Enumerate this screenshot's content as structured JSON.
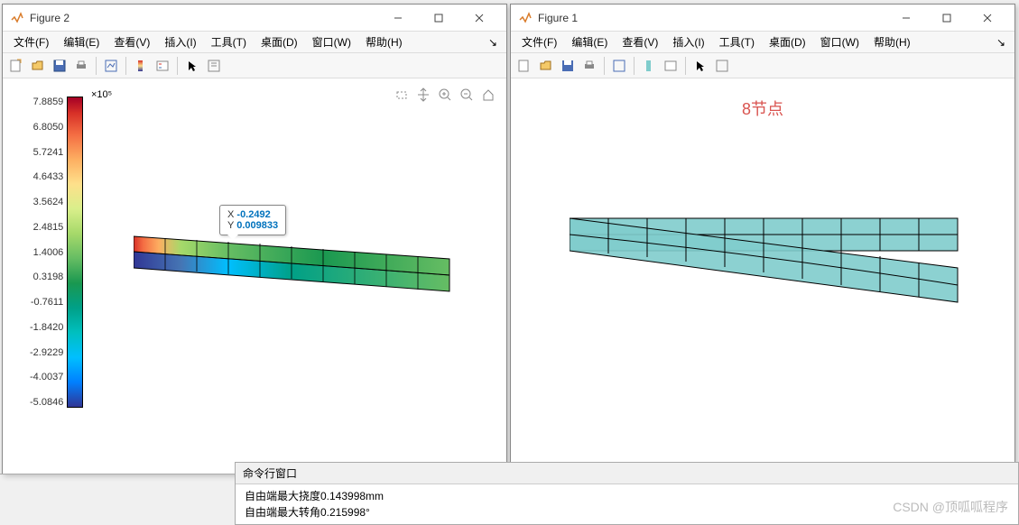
{
  "figure2": {
    "title": "Figure 2",
    "menus": [
      "文件(F)",
      "编辑(E)",
      "查看(V)",
      "插入(I)",
      "工具(T)",
      "桌面(D)",
      "窗口(W)",
      "帮助(H)"
    ],
    "colorbar_exp": "×10⁵",
    "colorbar_ticks": [
      "7.8859",
      "6.8050",
      "5.7241",
      "4.6433",
      "3.5624",
      "2.4815",
      "1.4006",
      "0.3198",
      "-0.7611",
      "-1.8420",
      "-2.9229",
      "-4.0037",
      "-5.0846"
    ],
    "datatip": {
      "x_label": "X",
      "x_val": "-0.2492",
      "y_label": "Y",
      "y_val": "0.009833"
    }
  },
  "figure1": {
    "title": "Figure 1",
    "menus": [
      "文件(F)",
      "编辑(E)",
      "查看(V)",
      "插入(I)",
      "工具(T)",
      "桌面(D)",
      "窗口(W)",
      "帮助(H)"
    ],
    "plot_title": "8节点"
  },
  "cmdwin": {
    "title": "命令行窗口",
    "lines": [
      "自由端最大挠度0.143998mm",
      "自由端最大转角0.215998°"
    ]
  },
  "watermark": "CSDN @顶呱呱程序",
  "chart_data": [
    {
      "type": "heatmap",
      "title": "Figure 2 stress contour (cantilever beam)",
      "colorbar_label": "×10^5",
      "colorbar_range": [
        -5.0846,
        7.8859
      ],
      "datatip": {
        "X": -0.2492,
        "Y": 0.009833
      },
      "mesh": {
        "columns": 10,
        "rows": 2,
        "elements": "8-node quadrilaterals",
        "deformed": true
      }
    },
    {
      "type": "mesh",
      "title": "8节点",
      "description": "Figure 1 undeformed vs deformed 10x2 mesh overlay",
      "mesh": {
        "columns": 10,
        "rows": 2,
        "color": "#7fcccc"
      }
    }
  ]
}
